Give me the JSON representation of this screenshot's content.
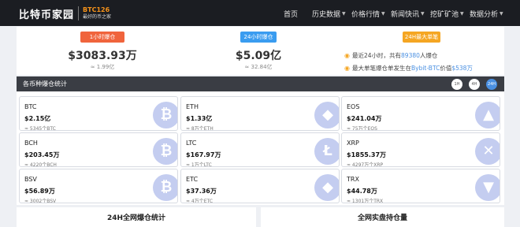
{
  "nav": {
    "logo_text": "比特币家园",
    "logo_code": "BTC126",
    "logo_slogan": "最好的币之家",
    "items": [
      {
        "label": "首页",
        "caret": false
      },
      {
        "label": "历史数据",
        "caret": true
      },
      {
        "label": "价格行情",
        "caret": true
      },
      {
        "label": "新闻快讯",
        "caret": true
      },
      {
        "label": "挖矿矿池",
        "caret": true
      },
      {
        "label": "数据分析",
        "caret": true
      }
    ]
  },
  "stats": {
    "h1": {
      "label": "1小时爆仓",
      "value": "$3083.93万",
      "sub": "≈ 1.99亿",
      "color": "#f0643c"
    },
    "h24": {
      "label": "24小时爆仓",
      "value": "$5.09亿",
      "sub": "≈ 32.84亿",
      "color": "#3a9cf0"
    },
    "max": {
      "label": "24H最大单笔",
      "color": "#f5a623"
    },
    "info1": {
      "pre": "最近24小时，共有",
      "count": "89380",
      "post": "人爆仓"
    },
    "info2": {
      "pre": "最大单笔爆仓单发生在",
      "exchange": "Bybit-BTC",
      "mid": "价值",
      "amount": "$538万"
    }
  },
  "coins_section": {
    "title": "各币种爆仓统计",
    "tabs": [
      "1H",
      "4H",
      "24H"
    ],
    "active_tab": "24H"
  },
  "coins": [
    {
      "name": "BTC",
      "value": "$2.15亿",
      "sub": "≈ 5345个BTC",
      "icon": "bitcoin-icon",
      "glyph": "₿"
    },
    {
      "name": "ETH",
      "value": "$1.33亿",
      "sub": "≈ 8万个ETH",
      "icon": "ethereum-icon",
      "glyph": "◆"
    },
    {
      "name": "EOS",
      "value": "$241.04万",
      "sub": "≈ 75万个EOS",
      "icon": "eos-icon",
      "glyph": "▲"
    },
    {
      "name": "BCH",
      "value": "$203.45万",
      "sub": "≈ 4220个BCH",
      "icon": "bitcoin-cash-icon",
      "glyph": "₿"
    },
    {
      "name": "LTC",
      "value": "$167.97万",
      "sub": "≈ 1万个LTC",
      "icon": "litecoin-icon",
      "glyph": "Ł"
    },
    {
      "name": "XRP",
      "value": "$1855.37万",
      "sub": "≈ 4297万个XRP",
      "icon": "ripple-icon",
      "glyph": "✕"
    },
    {
      "name": "BSV",
      "value": "$56.89万",
      "sub": "≈ 3002个BSV",
      "icon": "bsv-icon",
      "glyph": "₿"
    },
    {
      "name": "ETC",
      "value": "$37.36万",
      "sub": "≈ 4万个ETC",
      "icon": "ethereum-classic-icon",
      "glyph": "◆"
    },
    {
      "name": "TRX",
      "value": "$44.78万",
      "sub": "≈ 1301万个TRX",
      "icon": "tron-icon",
      "glyph": "▼"
    }
  ],
  "bottom": {
    "left_title": "24H全网爆仓统计",
    "right_title": "全网实盘持仓量"
  }
}
